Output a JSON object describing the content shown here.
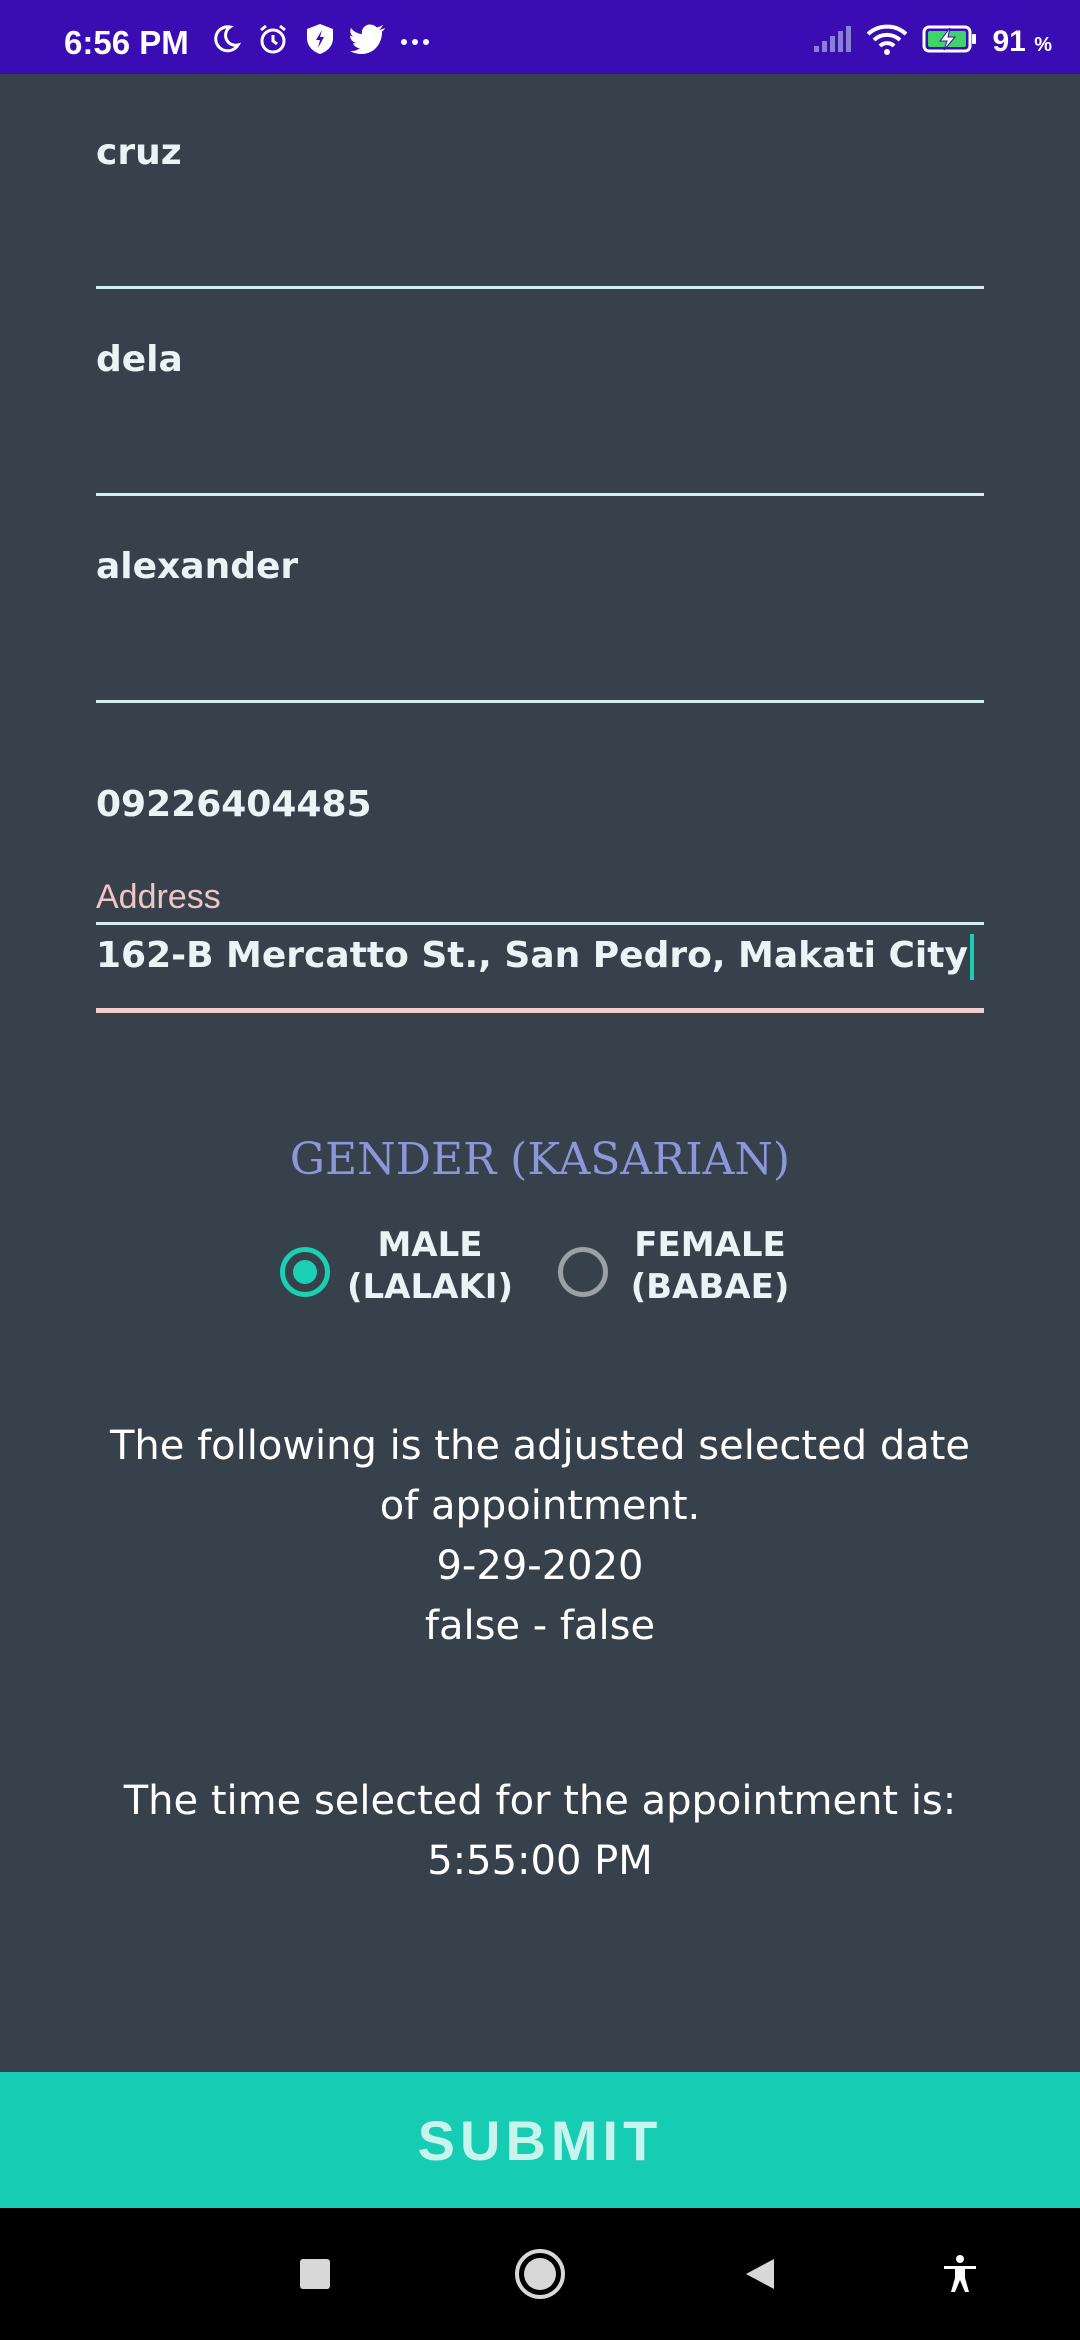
{
  "status_bar": {
    "time": "6:56 PM",
    "battery_percent": "91",
    "battery_unit": "%",
    "icons": [
      "moon-icon",
      "alarm-icon",
      "shield-icon",
      "twitter-icon",
      "more-icon",
      "signal-icon",
      "wifi-icon",
      "battery-charging-icon"
    ]
  },
  "form": {
    "fields": [
      {
        "value": "cruz"
      },
      {
        "value": "dela"
      },
      {
        "value": "alexander"
      },
      {
        "value": "09226404485"
      }
    ],
    "address": {
      "label": "Address",
      "value": "162-B Mercatto St., San Pedro, Makati City"
    }
  },
  "gender": {
    "title": "GENDER (KASARIAN)",
    "options": [
      {
        "line1": "MALE",
        "line2": "(LALAKI)",
        "selected": true
      },
      {
        "line1": "FEMALE",
        "line2": "(BABAE)",
        "selected": false
      }
    ]
  },
  "appointment": {
    "date_line1": "The following is the adjusted selected date",
    "date_line2": "of appointment.",
    "date_value": "9-29-2020",
    "flags": "false - false",
    "time_line": "The time selected for the appointment is:",
    "time_value": "5:55:00 PM"
  },
  "submit_label": "SUBMIT",
  "colors": {
    "background": "#36414b",
    "status_bar": "#3a0cb4",
    "accent": "#1bcfb4",
    "address_label": "#f4c4c4",
    "gender_title": "#8c96d8"
  }
}
